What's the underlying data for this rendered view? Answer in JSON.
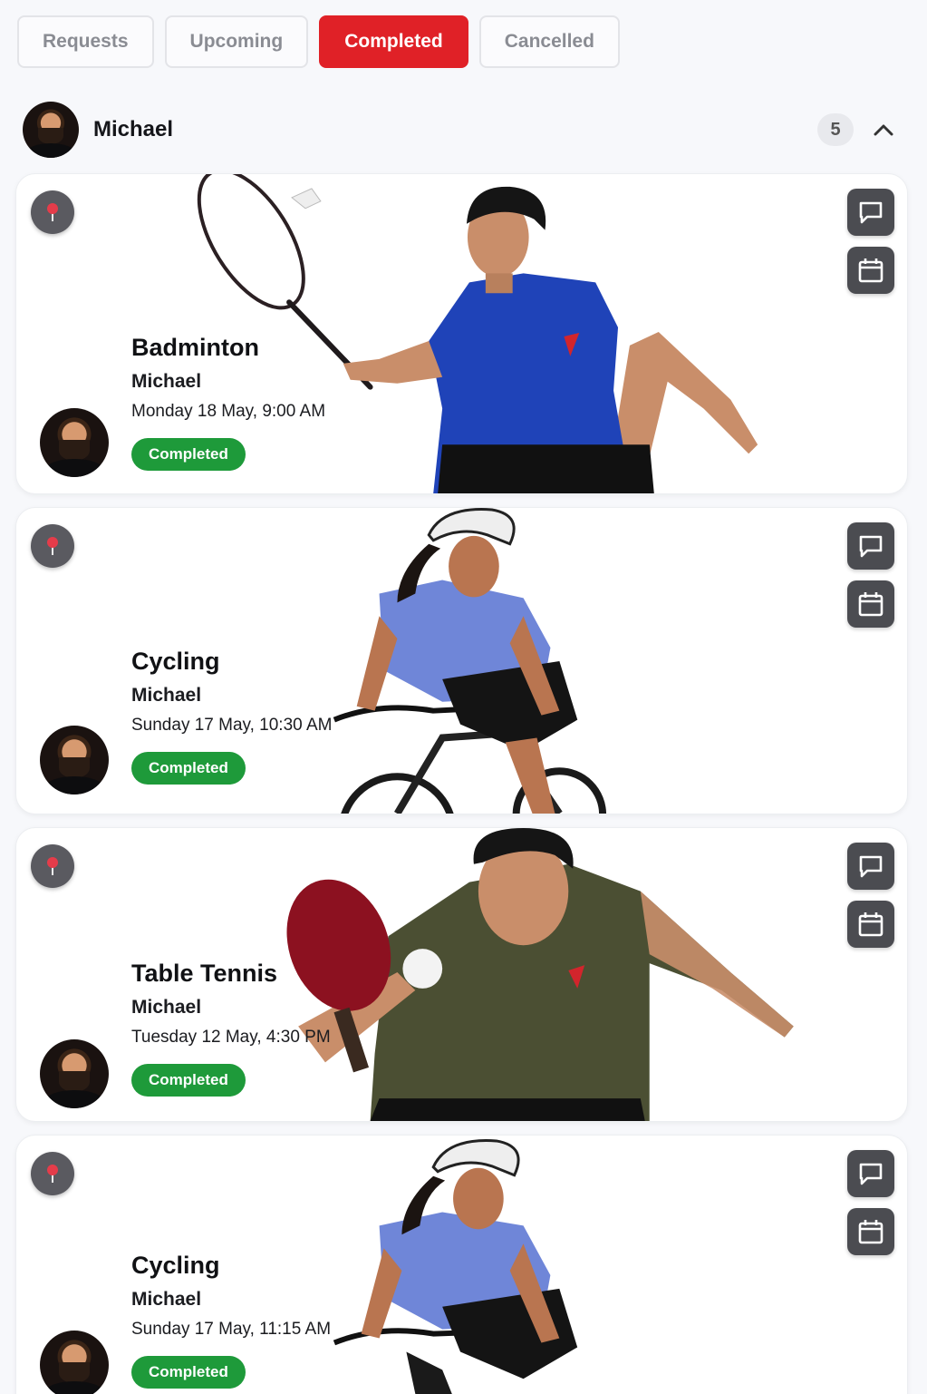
{
  "tabs": [
    {
      "label": "Requests",
      "active": false
    },
    {
      "label": "Upcoming",
      "active": false
    },
    {
      "label": "Completed",
      "active": true
    },
    {
      "label": "Cancelled",
      "active": false
    }
  ],
  "group": {
    "name": "Michael",
    "count": "5"
  },
  "bookings": [
    {
      "sport": "Badminton",
      "coach": "Michael",
      "datetime": "Monday 18 May, 9:00 AM",
      "status": "Completed",
      "shirt_color": "#1f43b8"
    },
    {
      "sport": "Cycling",
      "coach": "Michael",
      "datetime": "Sunday 17 May, 10:30 AM",
      "status": "Completed",
      "shirt_color": "#6f86d8"
    },
    {
      "sport": "Table Tennis",
      "coach": "Michael",
      "datetime": "Tuesday 12 May, 4:30 PM",
      "status": "Completed",
      "shirt_color": "#4b4f33"
    },
    {
      "sport": "Cycling",
      "coach": "Michael",
      "datetime": "Sunday 17 May, 11:15 AM",
      "status": "Completed",
      "shirt_color": "#6f86d8"
    }
  ],
  "colors": {
    "accent": "#e02127",
    "status_green": "#1e9a3a",
    "action_bg": "#4b4c51"
  },
  "icons": {
    "pin": "location-pin-icon",
    "chat": "chat-icon",
    "calendar": "calendar-icon",
    "collapse": "chevron-up-icon"
  }
}
